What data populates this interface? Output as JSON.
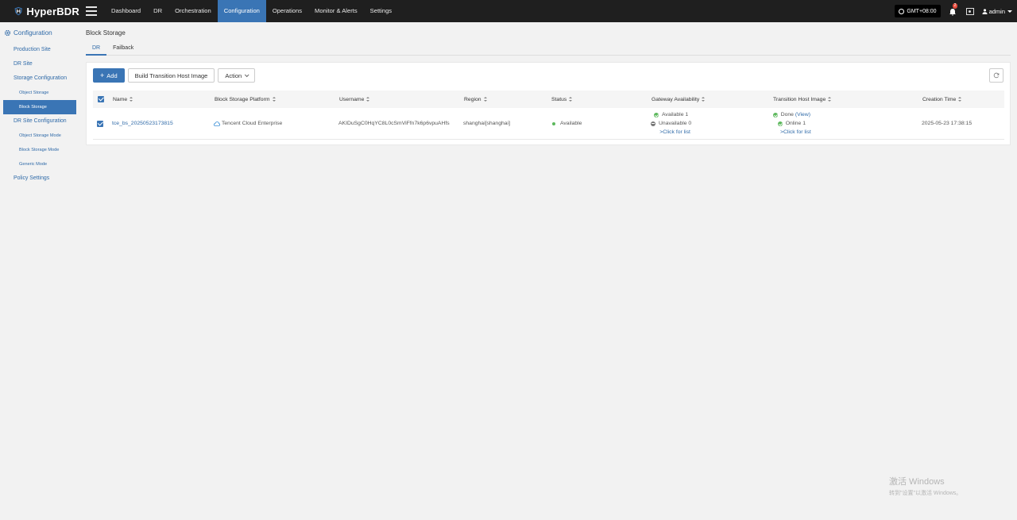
{
  "app": {
    "name": "HyperBDR"
  },
  "nav": {
    "items": [
      {
        "label": "Dashboard"
      },
      {
        "label": "DR"
      },
      {
        "label": "Orchestration"
      },
      {
        "label": "Configuration",
        "active": true
      },
      {
        "label": "Operations"
      },
      {
        "label": "Monitor & Alerts"
      },
      {
        "label": "Settings"
      }
    ]
  },
  "topright": {
    "timezone": "GMT+08:00",
    "notifications": "2",
    "user": "admin"
  },
  "sidebar": {
    "heading": "Configuration",
    "items": [
      {
        "label": "Production Site",
        "level": 1
      },
      {
        "label": "DR Site",
        "level": 1
      },
      {
        "label": "Storage Configuration",
        "level": 1
      },
      {
        "label": "Object Storage",
        "level": 2
      },
      {
        "label": "Block Storage",
        "level": 2,
        "active": true
      },
      {
        "label": "DR Site Configuration",
        "level": 1
      },
      {
        "label": "Object Storage Mode",
        "level": 2
      },
      {
        "label": "Block Storage Mode",
        "level": 2
      },
      {
        "label": "Generic Mode",
        "level": 2
      },
      {
        "label": "Policy Settings",
        "level": 1
      }
    ]
  },
  "page": {
    "title": "Block Storage"
  },
  "tabs": [
    {
      "label": "DR",
      "active": true
    },
    {
      "label": "Failback"
    }
  ],
  "toolbar": {
    "add": "Add",
    "build": "Build Transition Host Image",
    "action": "Action"
  },
  "table": {
    "columns": [
      "Name",
      "Block Storage Platform",
      "Username",
      "Region",
      "Status",
      "Gateway Availability",
      "Transition Host Image",
      "Creation Time"
    ],
    "rows": [
      {
        "name": "tce_bs_20250523173815",
        "platform": "Tencent Cloud Enterprise",
        "username": "AKIDuSgC0HqYC8L0cSmViFfn7k6p6vpuAHfs",
        "region": "shanghai[shanghai]",
        "status": "Available",
        "gateway_available": "Available 1",
        "gateway_unavailable": "Unavailable 0",
        "gateway_link": ">Click for list",
        "image_done": "Done",
        "image_view": "(View)",
        "image_online": "Online 1",
        "image_link": ">Click for list",
        "created": "2025-05-23 17:38:15"
      }
    ]
  },
  "watermark": {
    "line1": "激活 Windows",
    "line2": "转到\"设置\"以激活 Windows。"
  },
  "colors": {
    "topbar": "#1f1f1f",
    "accent": "#3a75b5",
    "link": "#2f6aa8",
    "success": "#5cb85c"
  }
}
